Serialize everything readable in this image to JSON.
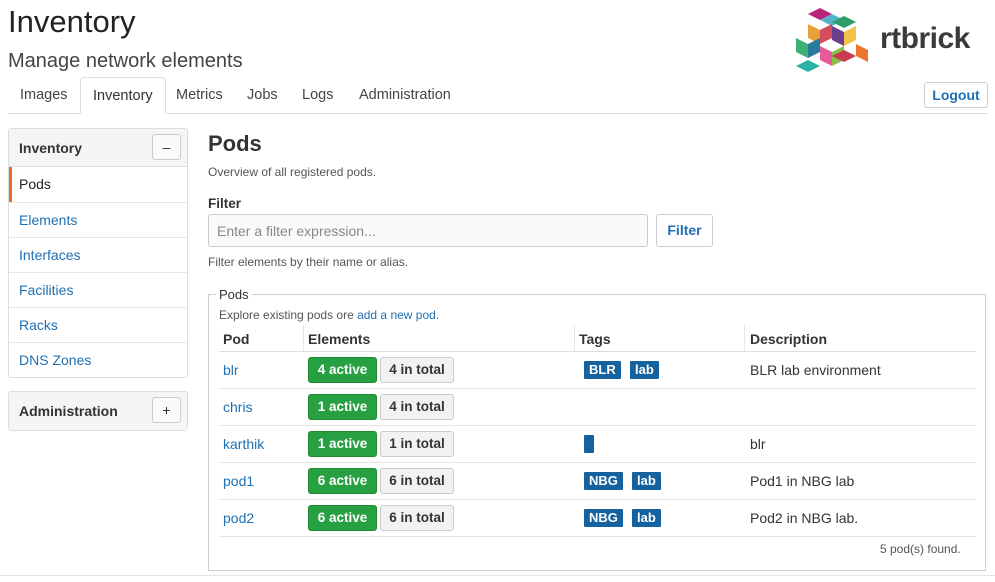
{
  "header": {
    "title": "Inventory",
    "subtitle": "Manage network elements",
    "logo_text": "rtbrick",
    "logout_label": "Logout"
  },
  "nav": {
    "tabs": [
      {
        "label": "Images",
        "active": false
      },
      {
        "label": "Inventory",
        "active": true
      },
      {
        "label": "Metrics",
        "active": false
      },
      {
        "label": "Jobs",
        "active": false
      },
      {
        "label": "Logs",
        "active": false
      },
      {
        "label": "Administration",
        "active": false
      }
    ]
  },
  "sidebar": {
    "inventory": {
      "title": "Inventory",
      "toggle": "–",
      "items": [
        {
          "label": "Pods",
          "active": true
        },
        {
          "label": "Elements",
          "active": false
        },
        {
          "label": "Interfaces",
          "active": false
        },
        {
          "label": "Facilities",
          "active": false
        },
        {
          "label": "Racks",
          "active": false
        },
        {
          "label": "DNS Zones",
          "active": false
        }
      ]
    },
    "administration": {
      "title": "Administration",
      "toggle": "+"
    }
  },
  "main": {
    "title": "Pods",
    "description": "Overview of all registered pods.",
    "filter": {
      "label": "Filter",
      "placeholder": "Enter a filter expression...",
      "value": "",
      "button": "Filter",
      "help": "Filter elements by their name or alias."
    },
    "pods_panel": {
      "legend": "Pods",
      "explore_prefix": "Explore existing pods ore ",
      "explore_link": "add a new pod",
      "explore_suffix": ".",
      "columns": [
        "Pod",
        "Elements",
        "Tags",
        "Description"
      ],
      "rows": [
        {
          "pod": "blr",
          "active": "4 active",
          "total": "4 in total",
          "tags": [
            "BLR",
            "lab"
          ],
          "description": "BLR lab environment"
        },
        {
          "pod": "chris",
          "active": "1 active",
          "total": "4 in total",
          "tags": [],
          "description": ""
        },
        {
          "pod": "karthik",
          "active": "1 active",
          "total": "1 in total",
          "tags": [
            ""
          ],
          "description": "blr"
        },
        {
          "pod": "pod1",
          "active": "6 active",
          "total": "6 in total",
          "tags": [
            "NBG",
            "lab"
          ],
          "description": "Pod1 in NBG lab"
        },
        {
          "pod": "pod2",
          "active": "6 active",
          "total": "6 in total",
          "tags": [
            "NBG",
            "lab"
          ],
          "description": "Pod2 in NBG lab."
        }
      ],
      "found": "5 pod(s) found."
    }
  },
  "colors": {
    "link": "#1f6fb2",
    "active_green": "#26a040",
    "tag_blue": "#15629f",
    "sidebar_active_accent": "#e37123"
  }
}
